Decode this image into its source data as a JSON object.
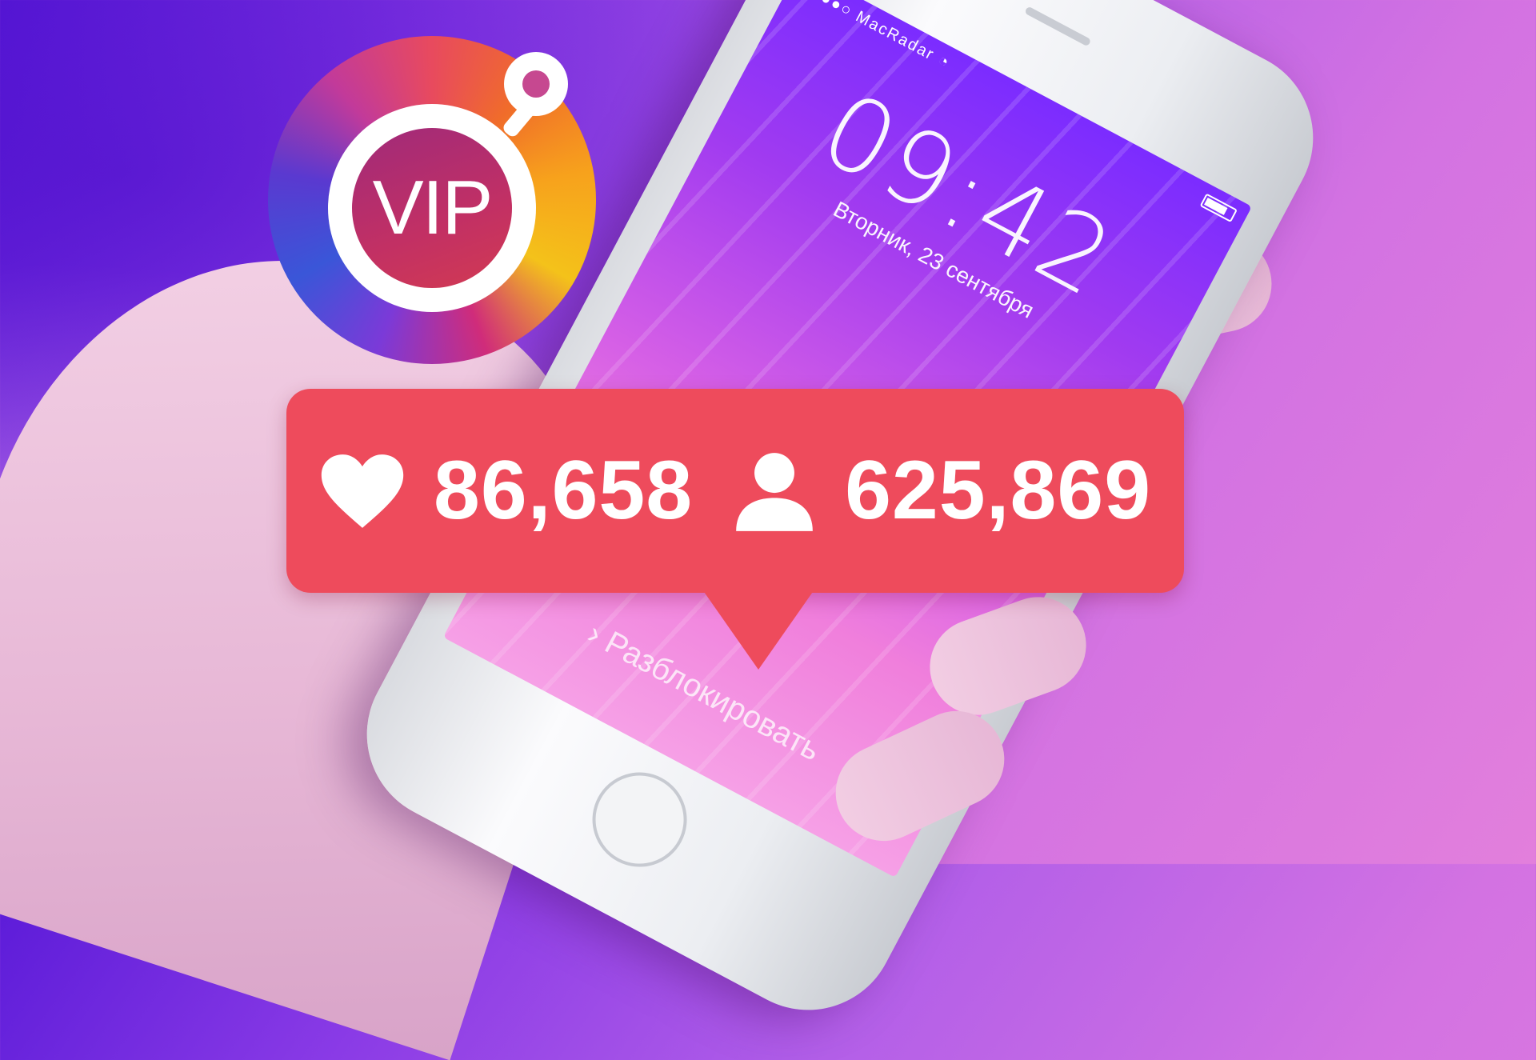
{
  "phone": {
    "carrier": "●●●●○ MacRadar",
    "time": "09:42",
    "date": "Вторник, 23 сентября",
    "unlock_text": "Разблокировать"
  },
  "badge": {
    "label": "VIP"
  },
  "notification": {
    "likes": "86,658",
    "followers": "625,869",
    "color": "#ee4b5c",
    "icons": [
      "heart-icon",
      "person-icon"
    ]
  }
}
